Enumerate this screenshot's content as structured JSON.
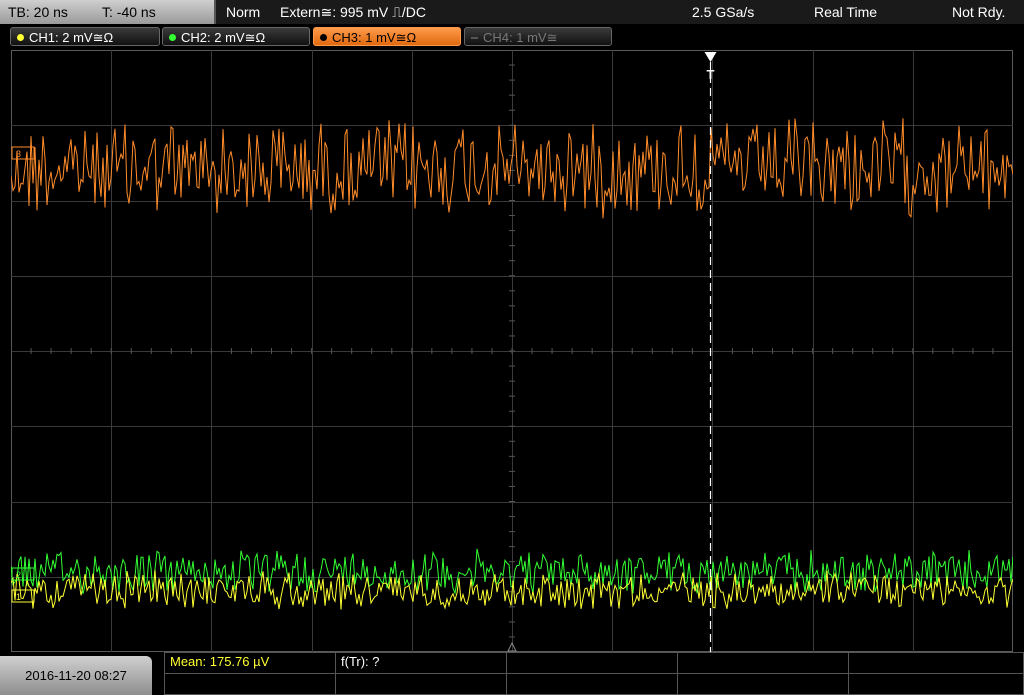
{
  "status": {
    "timebase": "TB: 20 ns",
    "trigger_offset": "T: -40 ns",
    "trigger_mode": "Norm",
    "trigger_source": "Extern≅: 995 mV ⎍/DC",
    "sample_rate": "2.5 GSa/s",
    "acq_mode": "Real Time",
    "state": "Not Rdy."
  },
  "channels": [
    {
      "label": "CH1: 2 mV≅Ω",
      "color": "#ffff33",
      "state": "on"
    },
    {
      "label": "CH2: 2 mV≅Ω",
      "color": "#33ff33",
      "state": "on"
    },
    {
      "label": "CH3: 1 mV≅Ω",
      "color": "#ff8c2a",
      "state": "active"
    },
    {
      "label": "CH4: 1 mV≅",
      "color": "#777777",
      "state": "off"
    }
  ],
  "markers": {
    "trigger": "T",
    "ch3_ref": "3",
    "ch2_ref": "2",
    "ch1_ref": "1"
  },
  "footer": {
    "datetime": "2016-11-20 08:27",
    "measurement1": "Mean: 175.76 µV",
    "measurement2": "f(Tr): ?"
  },
  "colors": {
    "grid": "#3a3a3a",
    "trigger_line": "#ffffff"
  }
}
